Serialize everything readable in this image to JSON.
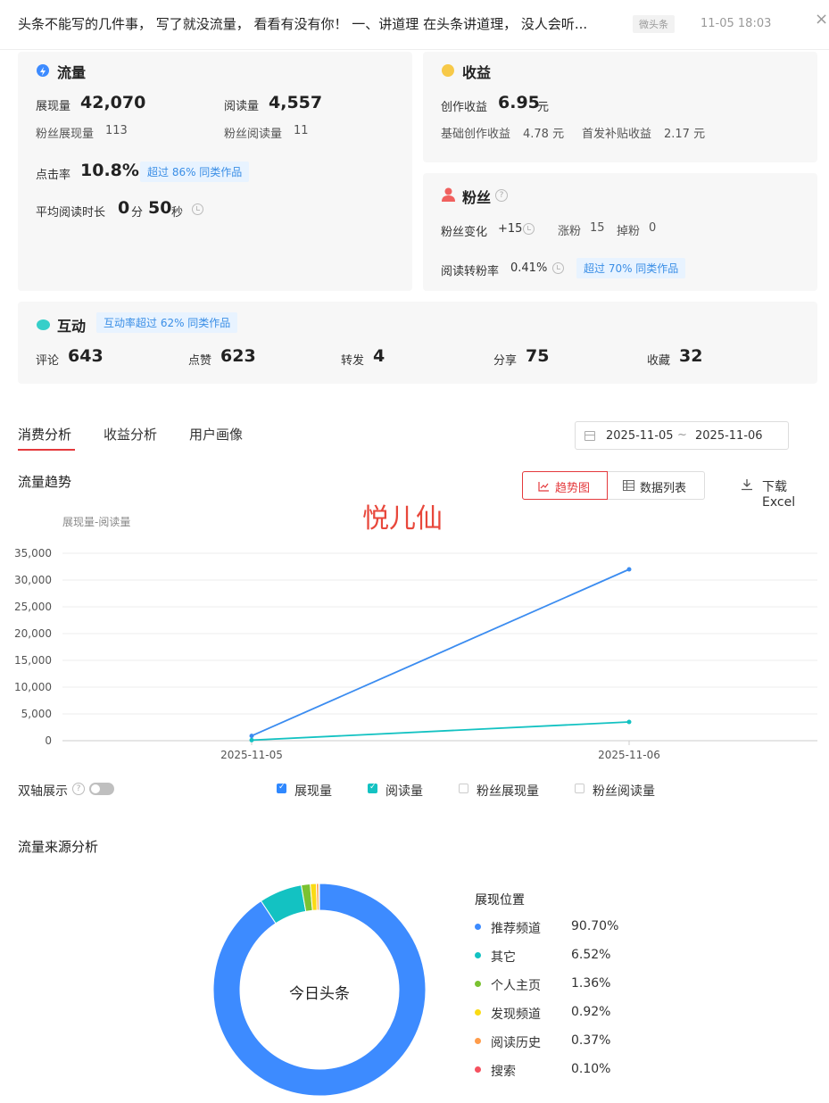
{
  "header": {
    "title": "头条不能写的几件事， 写了就没流量， 看看有没有你！ 一、讲道理 在头条讲道理， 没人会听...",
    "tag": "微头条",
    "time": "11-05 18:03",
    "close": "×"
  },
  "traffic": {
    "title": "流量",
    "impressions_label": "展现量",
    "impressions": "42,070",
    "reads_label": "阅读量",
    "reads": "4,557",
    "fan_impressions_label": "粉丝展现量",
    "fan_impressions": "113",
    "fan_reads_label": "粉丝阅读量",
    "fan_reads": "11",
    "ctr_label": "点击率",
    "ctr": "10.8%",
    "ctr_badge": "超过 86% 同类作品",
    "avg_read_label": "平均阅读时长",
    "avg_min": "0",
    "min_unit": "分",
    "avg_sec": "50",
    "sec_unit": "秒"
  },
  "income": {
    "title": "收益",
    "create_label": "创作收益",
    "create_value": "6.95",
    "yuan": "元",
    "basic_label": "基础创作收益",
    "basic_value": "4.78 元",
    "first_label": "首发补贴收益",
    "first_value": "2.17 元"
  },
  "fans": {
    "title": "粉丝",
    "change_label": "粉丝变化",
    "change_value": "+15",
    "gain_label": "涨粉",
    "gain_value": "15",
    "lose_label": "掉粉",
    "lose_value": "0",
    "conv_label": "阅读转粉率",
    "conv_value": "0.41%",
    "conv_badge": "超过 70% 同类作品"
  },
  "interact": {
    "title": "互动",
    "badge": "互动率超过 62% 同类作品",
    "items": [
      {
        "label": "评论",
        "value": "643"
      },
      {
        "label": "点赞",
        "value": "623"
      },
      {
        "label": "转发",
        "value": "4"
      },
      {
        "label": "分享",
        "value": "75"
      },
      {
        "label": "收藏",
        "value": "32"
      }
    ]
  },
  "tabs": [
    "消费分析",
    "收益分析",
    "用户画像"
  ],
  "date_range": {
    "start": "2025-11-05",
    "sep": "~",
    "end": "2025-11-06"
  },
  "trend": {
    "title": "流量趋势",
    "btn_trend": "趋势图",
    "btn_list": "数据列表",
    "download": "下载Excel",
    "watermark": "悦儿仙",
    "dual_axis": "双轴展示",
    "legend": [
      {
        "name": "展现量",
        "checked": true
      },
      {
        "name": "阅读量",
        "checked": true
      },
      {
        "name": "粉丝展现量",
        "checked": false
      },
      {
        "name": "粉丝阅读量",
        "checked": false
      }
    ]
  },
  "chart_data": [
    {
      "type": "line",
      "title": "",
      "ylabel": "展现量-阅读量",
      "x": [
        "2025-11-05",
        "2025-11-06"
      ],
      "ylim": [
        0,
        35000
      ],
      "yticks": [
        "0",
        "5,000",
        "10,000",
        "15,000",
        "20,000",
        "25,000",
        "30,000",
        "35,000"
      ],
      "series": [
        {
          "name": "展现量",
          "values": [
            900,
            32000
          ],
          "color": "#3b8cf0"
        },
        {
          "name": "阅读量",
          "values": [
            100,
            3500
          ],
          "color": "#13c2c2"
        }
      ],
      "grid": true
    },
    {
      "type": "pie",
      "title": "流量来源分析",
      "center_label": "今日头条",
      "legend_title": "展现位置",
      "slices": [
        {
          "name": "推荐频道",
          "value": 90.7,
          "label": "90.70%",
          "color": "#3d8bff"
        },
        {
          "name": "其它",
          "value": 6.52,
          "label": "6.52%",
          "color": "#13c2c2"
        },
        {
          "name": "个人主页",
          "value": 1.36,
          "label": "1.36%",
          "color": "#7ac231"
        },
        {
          "name": "发现频道",
          "value": 0.92,
          "label": "0.92%",
          "color": "#fadb14"
        },
        {
          "name": "阅读历史",
          "value": 0.37,
          "label": "0.37%",
          "color": "#ff9c4a"
        },
        {
          "name": "搜索",
          "value": 0.1,
          "label": "0.10%",
          "color": "#f5515f"
        }
      ]
    }
  ]
}
